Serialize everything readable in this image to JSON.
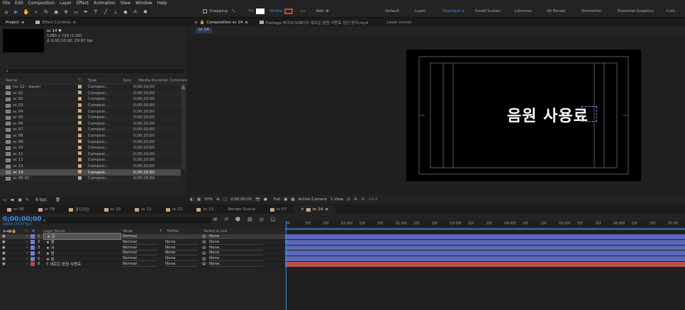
{
  "menu": [
    "File",
    "Edit",
    "Composition",
    "Layer",
    "Effect",
    "Animation",
    "View",
    "Window",
    "Help"
  ],
  "toolbar": {
    "snapping": "Snapping",
    "fill": "Fill",
    "stroke": "Stroke",
    "stroke_px": "- px",
    "add": "Add",
    "workspaces": [
      "Default",
      "Learn",
      "Standard",
      "Small Screen",
      "Libraries",
      "All Panels",
      "Animation",
      "Essential Graphics",
      "Colo"
    ],
    "active_workspace": "Standard"
  },
  "project": {
    "tab": "Project",
    "tab2": "Effect Controls",
    "comp_name": "sc 14 ▼",
    "comp_info1": "1280 x 720 (1.00)",
    "comp_info2": "Δ 0;00;10;00, 29.97 fps",
    "search_placeholder": "",
    "columns": {
      "name": "Name",
      "type": "Type",
      "size": "Size",
      "duration": "Media Duration",
      "comment": "Commen"
    },
    "items": [
      {
        "name": "[sc 12 - wave]",
        "type": "Composi...",
        "duration": "0;00;10;00"
      },
      {
        "name": "sc 01",
        "type": "Composi...",
        "duration": "0;00;10;00"
      },
      {
        "name": "sc 02",
        "type": "Composi...",
        "duration": "0;00;10;00"
      },
      {
        "name": "sc 03",
        "type": "Composi...",
        "duration": "0;00;10;00"
      },
      {
        "name": "sc 04",
        "type": "Composi...",
        "duration": "0;00;10;00"
      },
      {
        "name": "sc 05",
        "type": "Composi...",
        "duration": "0;00;10;00"
      },
      {
        "name": "sc 06",
        "type": "Composi...",
        "duration": "0;00;10;00"
      },
      {
        "name": "sc 07",
        "type": "Composi...",
        "duration": "0;00;10;00"
      },
      {
        "name": "sc 08",
        "type": "Composi...",
        "duration": "0;00;15;00"
      },
      {
        "name": "sc 09",
        "type": "Composi...",
        "duration": "0;00;15;00"
      },
      {
        "name": "sc 10",
        "type": "Composi...",
        "duration": "0;00;10;00"
      },
      {
        "name": "sc 11",
        "type": "Composi...",
        "duration": "0;00;10;00"
      },
      {
        "name": "sc 12",
        "type": "Composi...",
        "duration": "0;00;10;00"
      },
      {
        "name": "sc 13",
        "type": "Composi...",
        "duration": "0;00;10;00"
      },
      {
        "name": "sc 14",
        "type": "Composi...",
        "duration": "0;00;10;00"
      },
      {
        "name": "sc 08-01",
        "type": "Composi...",
        "duration": "0;00;15;00"
      }
    ],
    "bpc": "8 bpc"
  },
  "viewer": {
    "tab": "Composition sc 14",
    "footage_tab": "Footage 바이브(VIBE)의 새로운 음원 사용료 정산 방식.mp4",
    "layer_tab": "Layer (none)",
    "crumb": "sc 14",
    "text": "음원 사용료",
    "zoom": "50%",
    "timecode": "0;00;00;00",
    "quality": "Full",
    "camera": "Active Camera",
    "views": "1 View",
    "exposure": "+0.0"
  },
  "timeline": {
    "tabs": [
      "sc 08",
      "sc 09",
      "혼디자인",
      "sc 10",
      "sc 11",
      "sc 12",
      "sc 13",
      "Render Queue",
      "sc 07",
      "sc 14"
    ],
    "tab_colors": [
      "#c8a888",
      "#c8a888",
      "#c8a888",
      "#c8a888",
      "#c8a888",
      "#c8a888",
      "#c8a888",
      "",
      "#c8a888",
      "#c8a888"
    ],
    "active_tab": "sc 14",
    "current_time": "0;00;00;00",
    "frame_info": "00000 (29.97 fps)",
    "col_layer_name": "Layer Name",
    "col_mode": "Mode",
    "col_t": "T",
    "col_trkmat": "TrkMat",
    "col_parent": "Parent & Link",
    "layers": [
      {
        "num": "1",
        "name": "★ 료",
        "mode": "Normal",
        "trkmat": "",
        "parent": "None",
        "color": "#6d7fd8",
        "selected": true
      },
      {
        "num": "2",
        "name": "★ 용",
        "mode": "Normal",
        "trkmat": "None",
        "parent": "None",
        "color": "#6d7fd8",
        "selected": false
      },
      {
        "num": "3",
        "name": "★ 사",
        "mode": "Normal",
        "trkmat": "None",
        "parent": "None",
        "color": "#6d7fd8",
        "selected": false
      },
      {
        "num": "4",
        "name": "★ 원",
        "mode": "Normal",
        "trkmat": "None",
        "parent": "None",
        "color": "#6d7fd8",
        "selected": false
      },
      {
        "num": "5",
        "name": "★ 음",
        "mode": "Normal",
        "trkmat": "None",
        "parent": "None",
        "color": "#6d7fd8",
        "selected": false
      },
      {
        "num": "6",
        "name": "T 새로운 음원 사용료",
        "mode": "Normal",
        "trkmat": "None",
        "parent": "None",
        "color": "#c84848",
        "selected": false
      }
    ],
    "ruler": [
      "0f",
      "10f",
      "20f",
      "01:00f",
      "10f",
      "20f",
      "02:00f",
      "10f",
      "20f",
      "03:00f",
      "10f",
      "20f",
      "04:00f",
      "10f",
      "20f",
      "05:00f",
      "10f",
      "20f",
      "06:00f",
      "10f",
      "20f",
      "07:00"
    ],
    "bar_colors": [
      "#5a68b8",
      "#5a68b8",
      "#5a68b8",
      "#5a68b8",
      "#5a68b8",
      "#b85050"
    ]
  }
}
